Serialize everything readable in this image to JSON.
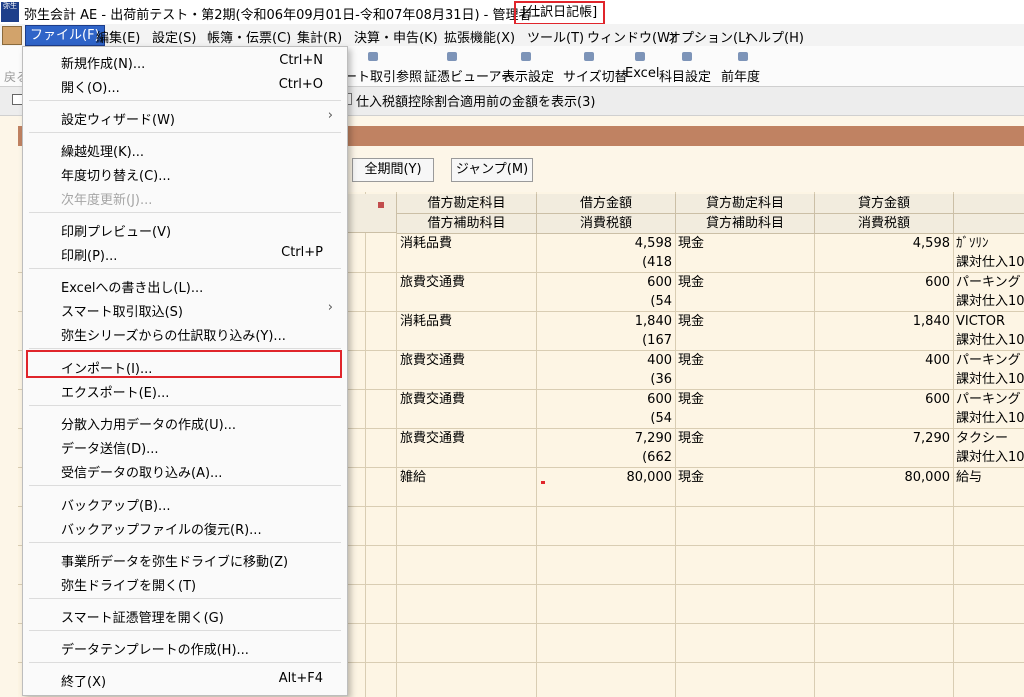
{
  "window": {
    "logo_text": "弥生",
    "title": "弥生会計 AE - 出荷前テスト・第2期(令和06年09月01日-令和07年08月31日) - 管理者 -",
    "mode": "[仕訳日記帳]"
  },
  "menubar": [
    "ファイル(F)",
    "編集(E)",
    "設定(S)",
    "帳簿・伝票(C)",
    "集計(R)",
    "決算・申告(K)",
    "拡張機能(X)",
    "ツール(T)",
    "ウィンドウ(W)",
    "オプション(L)",
    "ヘルプ(H)"
  ],
  "toolbar": {
    "back_label": "戻る",
    "buttons": [
      "ート取引参照",
      "証憑ビューアー",
      "表示設定",
      "サイズ切替",
      "Excel",
      "科目設定",
      "前年度"
    ]
  },
  "options": {
    "tax_checkbox_label": "仕入税額控除割合適用前の金額を表示(3)"
  },
  "buttons": {
    "all_period": "全期間(Y)",
    "jump": "ジャンプ(M)"
  },
  "table": {
    "headers_top": [
      "借方勘定科目",
      "借方金額",
      "貸方勘定科目",
      "貸方金額"
    ],
    "headers_bottom": [
      "借方補助科目",
      "消費税額",
      "貸方補助科目",
      "消費税額"
    ],
    "rows": [
      {
        "debit_account": "消耗品費",
        "debit_amount": "4,598",
        "credit_account": "現金",
        "credit_amount": "4,598",
        "memo": "ｶﾞｿﾘﾝ",
        "tax": "(418",
        "tax_memo": "課対仕入10"
      },
      {
        "debit_account": "旅費交通費",
        "debit_amount": "600",
        "credit_account": "現金",
        "credit_amount": "600",
        "memo": "パーキング",
        "tax": "(54",
        "tax_memo": "課対仕入10"
      },
      {
        "debit_account": "消耗品費",
        "debit_amount": "1,840",
        "credit_account": "現金",
        "credit_amount": "1,840",
        "memo": "VICTOR",
        "tax": "(167",
        "tax_memo": "課対仕入10"
      },
      {
        "debit_account": "旅費交通費",
        "debit_amount": "400",
        "credit_account": "現金",
        "credit_amount": "400",
        "memo": "パーキング",
        "tax": "(36",
        "tax_memo": "課対仕入10"
      },
      {
        "debit_account": "旅費交通費",
        "debit_amount": "600",
        "credit_account": "現金",
        "credit_amount": "600",
        "memo": "パーキング",
        "tax": "(54",
        "tax_memo": "課対仕入10"
      },
      {
        "debit_account": "旅費交通費",
        "debit_amount": "7,290",
        "credit_account": "現金",
        "credit_amount": "7,290",
        "memo": "タクシー",
        "tax": "(662",
        "tax_memo": "課対仕入10"
      },
      {
        "debit_account": "雑給",
        "debit_amount": "80,000",
        "credit_account": "現金",
        "credit_amount": "80,000",
        "memo": "給与",
        "tax": "",
        "tax_memo": ""
      }
    ]
  },
  "file_menu": [
    {
      "label": "新規作成(N)...",
      "shortcut": "Ctrl+N"
    },
    {
      "label": "開く(O)...",
      "shortcut": "Ctrl+O"
    },
    {
      "label": "設定ウィザード(W)",
      "submenu": true
    },
    {
      "label": "繰越処理(K)..."
    },
    {
      "label": "年度切り替え(C)..."
    },
    {
      "label": "次年度更新(J)...",
      "disabled": true
    },
    {
      "label": "印刷プレビュー(V)"
    },
    {
      "label": "印刷(P)...",
      "shortcut": "Ctrl+P"
    },
    {
      "label": "Excelへの書き出し(L)..."
    },
    {
      "label": "スマート取引取込(S)",
      "submenu": true
    },
    {
      "label": "弥生シリーズからの仕訳取り込み(Y)..."
    },
    {
      "label": "インポート(I)...",
      "highlighted": true
    },
    {
      "label": "エクスポート(E)..."
    },
    {
      "label": "分散入力用データの作成(U)..."
    },
    {
      "label": "データ送信(D)..."
    },
    {
      "label": "受信データの取り込み(A)..."
    },
    {
      "label": "バックアップ(B)..."
    },
    {
      "label": "バックアップファイルの復元(R)..."
    },
    {
      "label": "事業所データを弥生ドライブに移動(Z)"
    },
    {
      "label": "弥生ドライブを開く(T)"
    },
    {
      "label": "スマート証憑管理を開く(G)"
    },
    {
      "label": "データテンプレートの作成(H)..."
    },
    {
      "label": "終了(X)",
      "shortcut": "Alt+F4"
    }
  ]
}
